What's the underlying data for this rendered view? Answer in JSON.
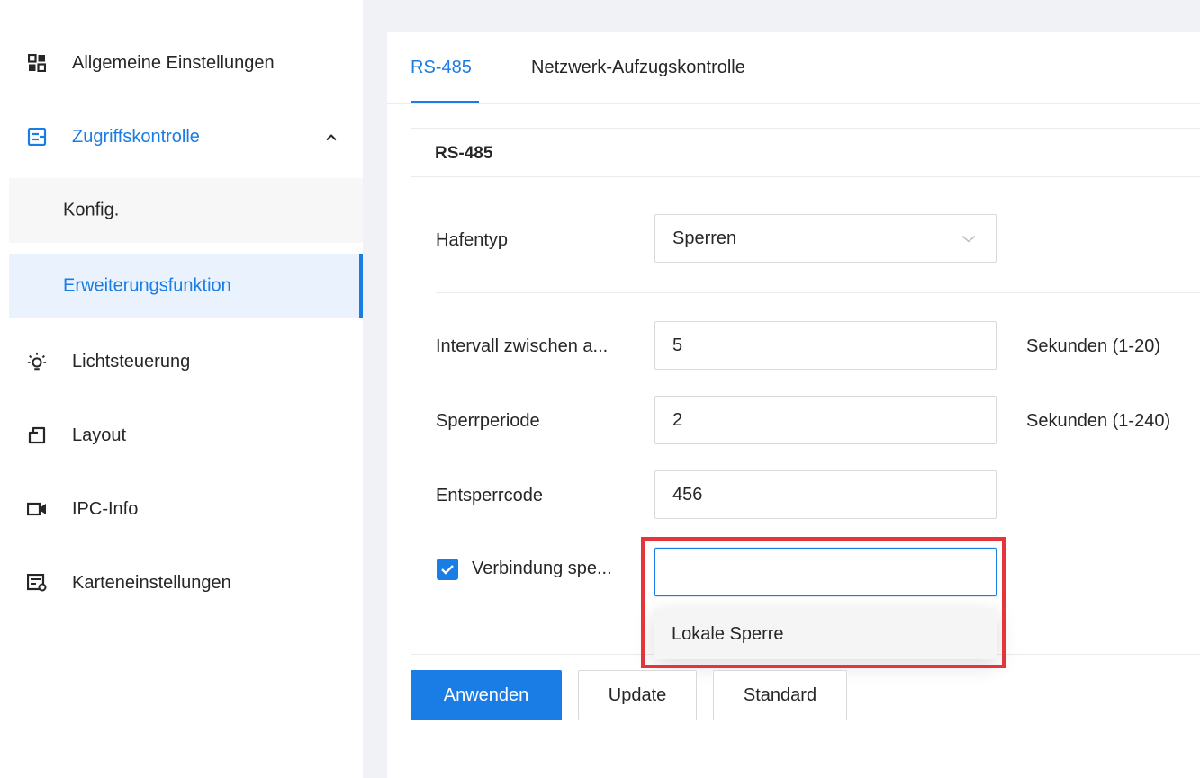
{
  "sidebar": {
    "items": [
      {
        "label": "Allgemeine Einstellungen",
        "icon": "grid-icon"
      },
      {
        "label": "Zugriffskontrolle",
        "icon": "door-access-icon",
        "expanded": true
      },
      {
        "label": "Lichtsteuerung",
        "icon": "light-bulb-icon"
      },
      {
        "label": "Layout",
        "icon": "layout-icon"
      },
      {
        "label": "IPC-Info",
        "icon": "camera-icon"
      },
      {
        "label": "Karteneinstellungen",
        "icon": "card-settings-icon"
      }
    ],
    "sub_items": [
      {
        "label": "Konfig."
      },
      {
        "label": "Erweiterungsfunktion",
        "active": true
      }
    ]
  },
  "tabs": [
    {
      "label": "RS-485",
      "active": true
    },
    {
      "label": "Netzwerk-Aufzugskontrolle",
      "active": false
    }
  ],
  "card": {
    "title": "RS-485",
    "port_type": {
      "label": "Hafentyp",
      "value": "Sperren"
    },
    "interval": {
      "label": "Intervall zwischen a...",
      "value": "5",
      "unit": "Sekunden (1-20)"
    },
    "lock_period": {
      "label": "Sperrperiode",
      "value": "2",
      "unit": "Sekunden (1-240)"
    },
    "unlock_code": {
      "label": "Entsperrcode",
      "value": "456"
    },
    "connection_lock": {
      "label": "Verbindung spe...",
      "checked": true,
      "value": ""
    },
    "dropdown_options": [
      "Lokale Sperre"
    ]
  },
  "buttons": {
    "apply": "Anwenden",
    "update": "Update",
    "default": "Standard"
  },
  "colors": {
    "accent": "#1a7ce5",
    "highlight": "#e4353a"
  }
}
